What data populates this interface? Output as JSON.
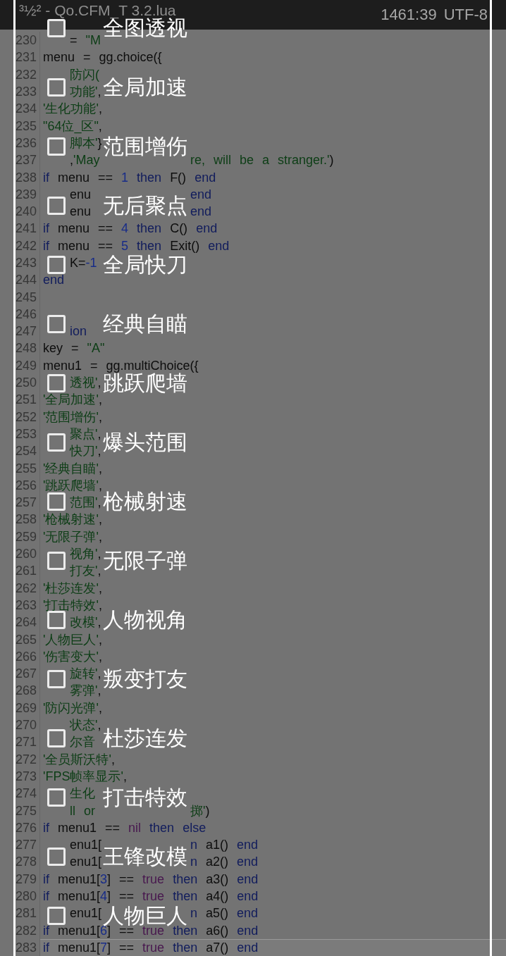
{
  "editor": {
    "title_bar": {
      "title": "³½² - Qo.CFM_T 3.2.lua",
      "cursor_position": "1461:39",
      "encoding": "UTF-8"
    },
    "lines": [
      {
        "number": "230",
        "current": false,
        "kind": "split",
        "middle": [
          {
            "kind": "plain",
            "text": "= "
          },
          {
            "kind": "string",
            "text": "\"M"
          }
        ]
      },
      {
        "number": "231",
        "current": false,
        "kind": "full",
        "tokens": [
          {
            "kind": "plain",
            "text": "menu = gg.choice({"
          }
        ]
      },
      {
        "number": "232",
        "current": false,
        "kind": "split",
        "middle": [
          {
            "kind": "string",
            "text": "防闪("
          }
        ]
      },
      {
        "number": "233",
        "current": false,
        "kind": "split",
        "middle": [
          {
            "kind": "string",
            "text": "功能'"
          },
          {
            "kind": "plain",
            "text": ","
          }
        ]
      },
      {
        "number": "234",
        "current": false,
        "kind": "full",
        "tokens": [
          {
            "kind": "string",
            "text": "'生化功能'"
          },
          {
            "kind": "plain",
            "text": ","
          }
        ]
      },
      {
        "number": "235",
        "current": false,
        "kind": "full",
        "tokens": [
          {
            "kind": "string",
            "text": "\"64位_区\""
          },
          {
            "kind": "plain",
            "text": ","
          }
        ]
      },
      {
        "number": "236",
        "current": false,
        "kind": "split",
        "middle": [
          {
            "kind": "string",
            "text": "脚本'"
          },
          {
            "kind": "plain",
            "text": "}"
          }
        ]
      },
      {
        "number": "237",
        "current": false,
        "kind": "split",
        "middle": [
          {
            "kind": "plain",
            "text": ","
          },
          {
            "kind": "string",
            "text": "'May"
          }
        ],
        "right": [
          {
            "kind": "string",
            "text": "re, will be a stranger.'"
          },
          {
            "kind": "plain",
            "text": ")"
          }
        ]
      },
      {
        "number": "238",
        "current": false,
        "kind": "full",
        "tokens": [
          {
            "kind": "keyword",
            "text": "if"
          },
          {
            "kind": "plain",
            "text": " menu == "
          },
          {
            "kind": "number",
            "text": "1"
          },
          {
            "kind": "keyword",
            "text": " then"
          },
          {
            "kind": "plain",
            "text": " F() "
          },
          {
            "kind": "keyword",
            "text": "end"
          }
        ]
      },
      {
        "number": "239",
        "current": false,
        "kind": "split",
        "middle": [
          {
            "kind": "plain",
            "text": "enu"
          }
        ],
        "right": [
          {
            "kind": "keyword",
            "text": "end"
          }
        ]
      },
      {
        "number": "240",
        "current": false,
        "kind": "split",
        "middle": [
          {
            "kind": "plain",
            "text": "enu"
          }
        ],
        "right": [
          {
            "kind": "keyword",
            "text": "end"
          }
        ]
      },
      {
        "number": "241",
        "current": false,
        "kind": "full",
        "tokens": [
          {
            "kind": "keyword",
            "text": "if"
          },
          {
            "kind": "plain",
            "text": " menu == "
          },
          {
            "kind": "number",
            "text": "4"
          },
          {
            "kind": "keyword",
            "text": " then"
          },
          {
            "kind": "plain",
            "text": " C() "
          },
          {
            "kind": "keyword",
            "text": "end"
          }
        ]
      },
      {
        "number": "242",
        "current": false,
        "kind": "full",
        "tokens": [
          {
            "kind": "keyword",
            "text": "if"
          },
          {
            "kind": "plain",
            "text": " menu == "
          },
          {
            "kind": "number",
            "text": "5"
          },
          {
            "kind": "keyword",
            "text": " then"
          },
          {
            "kind": "plain",
            "text": " Exit() "
          },
          {
            "kind": "keyword",
            "text": "end"
          }
        ]
      },
      {
        "number": "243",
        "current": false,
        "kind": "split",
        "middle": [
          {
            "kind": "plain",
            "text": "K="
          },
          {
            "kind": "number",
            "text": "-1"
          }
        ]
      },
      {
        "number": "244",
        "current": false,
        "kind": "full",
        "tokens": [
          {
            "kind": "keyword",
            "text": "end"
          }
        ]
      },
      {
        "number": "245",
        "current": false,
        "kind": "full"
      },
      {
        "number": "246",
        "current": false,
        "kind": "full"
      },
      {
        "number": "247",
        "current": false,
        "kind": "split",
        "middle": [
          {
            "kind": "keyword",
            "text": "ion"
          }
        ]
      },
      {
        "number": "248",
        "current": false,
        "kind": "full",
        "tokens": [
          {
            "kind": "plain",
            "text": "key = "
          },
          {
            "kind": "string",
            "text": "\"A\""
          }
        ]
      },
      {
        "number": "249",
        "current": false,
        "kind": "full",
        "tokens": [
          {
            "kind": "plain",
            "text": "menu1 = gg.multiChoice({"
          }
        ]
      },
      {
        "number": "250",
        "current": false,
        "kind": "split",
        "middle": [
          {
            "kind": "string",
            "text": "透视'"
          },
          {
            "kind": "plain",
            "text": ","
          }
        ]
      },
      {
        "number": "251",
        "current": false,
        "kind": "full",
        "tokens": [
          {
            "kind": "string",
            "text": "'全局加速'"
          },
          {
            "kind": "plain",
            "text": ","
          }
        ]
      },
      {
        "number": "252",
        "current": false,
        "kind": "full",
        "tokens": [
          {
            "kind": "string",
            "text": "'范围增伤'"
          },
          {
            "kind": "plain",
            "text": ","
          }
        ]
      },
      {
        "number": "253",
        "current": false,
        "kind": "split",
        "middle": [
          {
            "kind": "string",
            "text": "聚点'"
          },
          {
            "kind": "plain",
            "text": ","
          }
        ]
      },
      {
        "number": "254",
        "current": false,
        "kind": "split",
        "middle": [
          {
            "kind": "string",
            "text": "快刀'"
          },
          {
            "kind": "plain",
            "text": ","
          }
        ]
      },
      {
        "number": "255",
        "current": false,
        "kind": "full",
        "tokens": [
          {
            "kind": "string",
            "text": "'经典自瞄'"
          },
          {
            "kind": "plain",
            "text": ","
          }
        ]
      },
      {
        "number": "256",
        "current": false,
        "kind": "full",
        "tokens": [
          {
            "kind": "string",
            "text": "'跳跃爬墙'"
          },
          {
            "kind": "plain",
            "text": ","
          }
        ]
      },
      {
        "number": "257",
        "current": false,
        "kind": "split",
        "middle": [
          {
            "kind": "string",
            "text": "范围'"
          },
          {
            "kind": "plain",
            "text": ","
          }
        ]
      },
      {
        "number": "258",
        "current": false,
        "kind": "full",
        "tokens": [
          {
            "kind": "string",
            "text": "'枪械射速'"
          },
          {
            "kind": "plain",
            "text": ","
          }
        ]
      },
      {
        "number": "259",
        "current": false,
        "kind": "full",
        "tokens": [
          {
            "kind": "string",
            "text": "'无限子弹'"
          },
          {
            "kind": "plain",
            "text": ","
          }
        ]
      },
      {
        "number": "260",
        "current": false,
        "kind": "split",
        "middle": [
          {
            "kind": "string",
            "text": "视角'"
          },
          {
            "kind": "plain",
            "text": ","
          }
        ]
      },
      {
        "number": "261",
        "current": false,
        "kind": "split",
        "middle": [
          {
            "kind": "string",
            "text": "打友'"
          },
          {
            "kind": "plain",
            "text": ","
          }
        ]
      },
      {
        "number": "262",
        "current": false,
        "kind": "full",
        "tokens": [
          {
            "kind": "string",
            "text": "'杜莎连发'"
          },
          {
            "kind": "plain",
            "text": ","
          }
        ]
      },
      {
        "number": "263",
        "current": false,
        "kind": "full",
        "tokens": [
          {
            "kind": "string",
            "text": "'打击特效'"
          },
          {
            "kind": "plain",
            "text": ","
          }
        ]
      },
      {
        "number": "264",
        "current": false,
        "kind": "split",
        "middle": [
          {
            "kind": "string",
            "text": "改模'"
          },
          {
            "kind": "plain",
            "text": ","
          }
        ]
      },
      {
        "number": "265",
        "current": false,
        "kind": "full",
        "tokens": [
          {
            "kind": "string",
            "text": "'人物巨人'"
          },
          {
            "kind": "plain",
            "text": ","
          }
        ]
      },
      {
        "number": "266",
        "current": false,
        "kind": "full",
        "tokens": [
          {
            "kind": "string",
            "text": "'伤害变大'"
          },
          {
            "kind": "plain",
            "text": ","
          }
        ]
      },
      {
        "number": "267",
        "current": false,
        "kind": "split",
        "middle": [
          {
            "kind": "string",
            "text": "旋转'"
          },
          {
            "kind": "plain",
            "text": ","
          }
        ]
      },
      {
        "number": "268",
        "current": false,
        "kind": "split",
        "middle": [
          {
            "kind": "string",
            "text": "雾弹'"
          },
          {
            "kind": "plain",
            "text": ","
          }
        ]
      },
      {
        "number": "269",
        "current": false,
        "kind": "full",
        "tokens": [
          {
            "kind": "string",
            "text": "'防闪光弹'"
          },
          {
            "kind": "plain",
            "text": ","
          }
        ]
      },
      {
        "number": "270",
        "current": false,
        "kind": "split",
        "middle": [
          {
            "kind": "string",
            "text": "状态'"
          },
          {
            "kind": "plain",
            "text": ","
          }
        ]
      },
      {
        "number": "271",
        "current": false,
        "kind": "split",
        "middle": [
          {
            "kind": "string",
            "text": "尔音"
          }
        ]
      },
      {
        "number": "272",
        "current": false,
        "kind": "full",
        "tokens": [
          {
            "kind": "string",
            "text": "'全员斯沃特'"
          },
          {
            "kind": "plain",
            "text": ","
          }
        ]
      },
      {
        "number": "273",
        "current": false,
        "kind": "full",
        "tokens": [
          {
            "kind": "string",
            "text": "'FPS帧率显示'"
          },
          {
            "kind": "plain",
            "text": ","
          }
        ]
      },
      {
        "number": "274",
        "current": false,
        "kind": "split",
        "middle": [
          {
            "kind": "string",
            "text": "生化"
          }
        ]
      },
      {
        "number": "275",
        "current": false,
        "kind": "split",
        "middle": [
          {
            "kind": "string",
            "text": "ll or"
          }
        ],
        "right": [
          {
            "kind": "string",
            "text": "掷'"
          },
          {
            "kind": "plain",
            "text": ")"
          }
        ]
      },
      {
        "number": "276",
        "current": false,
        "kind": "full",
        "tokens": [
          {
            "kind": "keyword",
            "text": "if"
          },
          {
            "kind": "plain",
            "text": " menu1 == "
          },
          {
            "kind": "literal",
            "text": "nil"
          },
          {
            "kind": "keyword",
            "text": " then else"
          }
        ]
      },
      {
        "number": "277",
        "current": false,
        "kind": "split",
        "middle": [
          {
            "kind": "plain",
            "text": "enu1["
          }
        ],
        "right": [
          {
            "kind": "keyword",
            "text": "n"
          },
          {
            "kind": "plain",
            "text": " a1() "
          },
          {
            "kind": "keyword",
            "text": "end"
          }
        ]
      },
      {
        "number": "278",
        "current": false,
        "kind": "split",
        "middle": [
          {
            "kind": "plain",
            "text": "enu1["
          }
        ],
        "right": [
          {
            "kind": "keyword",
            "text": "n"
          },
          {
            "kind": "plain",
            "text": " a2() "
          },
          {
            "kind": "keyword",
            "text": "end"
          }
        ]
      },
      {
        "number": "279",
        "current": false,
        "kind": "full",
        "tokens": [
          {
            "kind": "keyword",
            "text": "if"
          },
          {
            "kind": "plain",
            "text": " menu1["
          },
          {
            "kind": "number",
            "text": "3"
          },
          {
            "kind": "plain",
            "text": "] == "
          },
          {
            "kind": "literal",
            "text": "true"
          },
          {
            "kind": "keyword",
            "text": " then"
          },
          {
            "kind": "plain",
            "text": " a3() "
          },
          {
            "kind": "keyword",
            "text": "end"
          }
        ]
      },
      {
        "number": "280",
        "current": false,
        "kind": "full",
        "tokens": [
          {
            "kind": "keyword",
            "text": "if"
          },
          {
            "kind": "plain",
            "text": " menu1["
          },
          {
            "kind": "number",
            "text": "4"
          },
          {
            "kind": "plain",
            "text": "] == "
          },
          {
            "kind": "literal",
            "text": "true"
          },
          {
            "kind": "keyword",
            "text": " then"
          },
          {
            "kind": "plain",
            "text": " a4() "
          },
          {
            "kind": "keyword",
            "text": "end"
          }
        ]
      },
      {
        "number": "281",
        "current": false,
        "kind": "split",
        "middle": [
          {
            "kind": "plain",
            "text": "enu1["
          }
        ],
        "right": [
          {
            "kind": "keyword",
            "text": "n"
          },
          {
            "kind": "plain",
            "text": " a5() "
          },
          {
            "kind": "keyword",
            "text": "end"
          }
        ]
      },
      {
        "number": "282",
        "current": false,
        "kind": "full",
        "tokens": [
          {
            "kind": "keyword",
            "text": "if"
          },
          {
            "kind": "plain",
            "text": " menu1["
          },
          {
            "kind": "number",
            "text": "6"
          },
          {
            "kind": "plain",
            "text": "] == "
          },
          {
            "kind": "literal",
            "text": "true"
          },
          {
            "kind": "keyword",
            "text": " then"
          },
          {
            "kind": "plain",
            "text": " a6() "
          },
          {
            "kind": "keyword",
            "text": "end"
          }
        ]
      },
      {
        "number": "283",
        "current": true,
        "kind": "full",
        "tokens": [
          {
            "kind": "keyword",
            "text": "if"
          },
          {
            "kind": "plain",
            "text": " menu1["
          },
          {
            "kind": "number",
            "text": "7"
          },
          {
            "kind": "plain",
            "text": "] == "
          },
          {
            "kind": "literal",
            "text": "true"
          },
          {
            "kind": "keyword",
            "text": " then"
          },
          {
            "kind": "plain",
            "text": " a7() "
          },
          {
            "kind": "keyword",
            "text": "end"
          }
        ]
      }
    ]
  },
  "dialog": {
    "options": [
      {
        "label": "全图透视",
        "checked": false
      },
      {
        "label": "全局加速",
        "checked": false
      },
      {
        "label": "范围增伤",
        "checked": false
      },
      {
        "label": "无后聚点",
        "checked": false
      },
      {
        "label": "全局快刀",
        "checked": false
      },
      {
        "label": "经典自瞄",
        "checked": false
      },
      {
        "label": "跳跃爬墙",
        "checked": false
      },
      {
        "label": "爆头范围",
        "checked": false
      },
      {
        "label": "枪械射速",
        "checked": false
      },
      {
        "label": "无限子弹",
        "checked": false
      },
      {
        "label": "人物视角",
        "checked": false
      },
      {
        "label": "叛变打友",
        "checked": false
      },
      {
        "label": "杜莎连发",
        "checked": false
      },
      {
        "label": "打击特效",
        "checked": false
      },
      {
        "label": "王锋改模",
        "checked": false
      },
      {
        "label": "人物巨人",
        "checked": false
      }
    ]
  }
}
